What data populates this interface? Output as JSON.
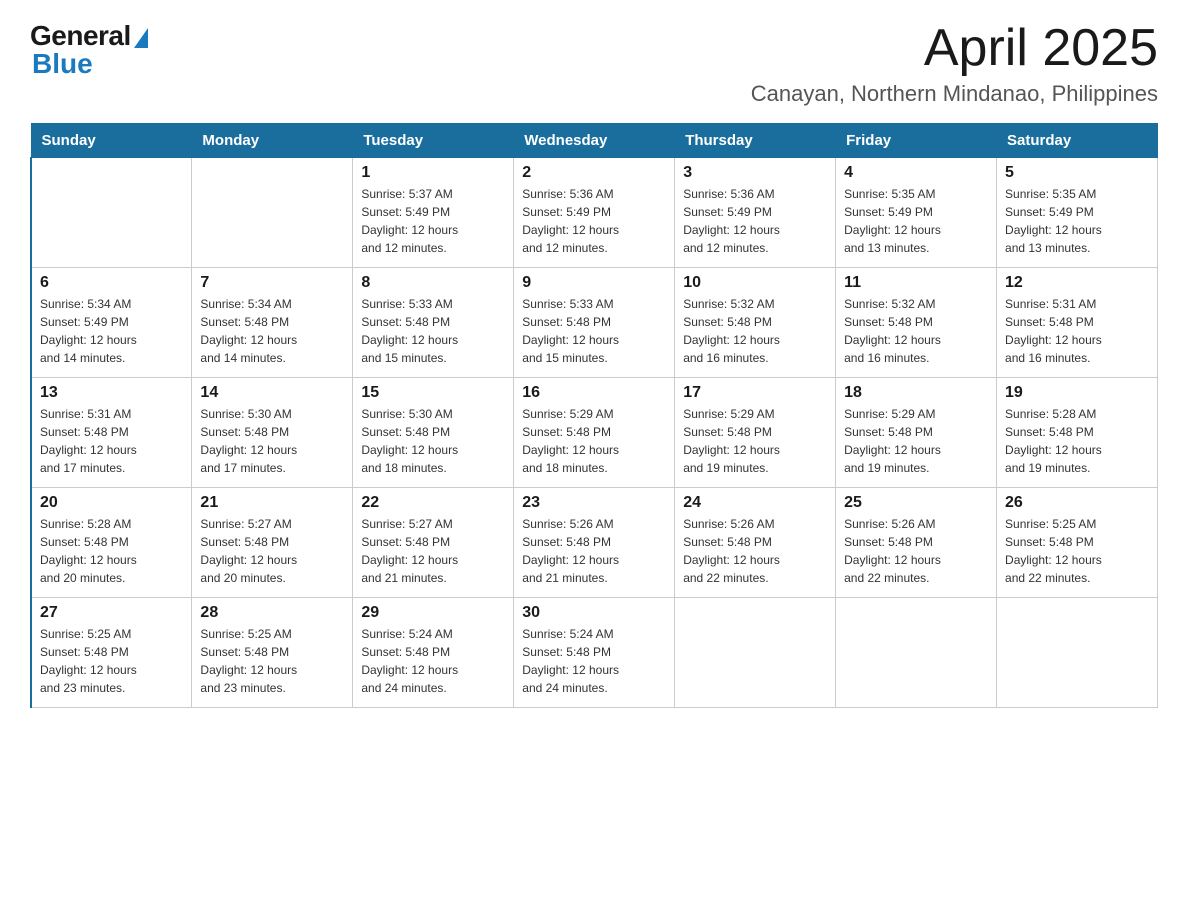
{
  "logo": {
    "general": "General",
    "blue": "Blue"
  },
  "title": "April 2025",
  "location": "Canayan, Northern Mindanao, Philippines",
  "days_of_week": [
    "Sunday",
    "Monday",
    "Tuesday",
    "Wednesday",
    "Thursday",
    "Friday",
    "Saturday"
  ],
  "weeks": [
    [
      {
        "day": "",
        "info": ""
      },
      {
        "day": "",
        "info": ""
      },
      {
        "day": "1",
        "info": "Sunrise: 5:37 AM\nSunset: 5:49 PM\nDaylight: 12 hours\nand 12 minutes."
      },
      {
        "day": "2",
        "info": "Sunrise: 5:36 AM\nSunset: 5:49 PM\nDaylight: 12 hours\nand 12 minutes."
      },
      {
        "day": "3",
        "info": "Sunrise: 5:36 AM\nSunset: 5:49 PM\nDaylight: 12 hours\nand 12 minutes."
      },
      {
        "day": "4",
        "info": "Sunrise: 5:35 AM\nSunset: 5:49 PM\nDaylight: 12 hours\nand 13 minutes."
      },
      {
        "day": "5",
        "info": "Sunrise: 5:35 AM\nSunset: 5:49 PM\nDaylight: 12 hours\nand 13 minutes."
      }
    ],
    [
      {
        "day": "6",
        "info": "Sunrise: 5:34 AM\nSunset: 5:49 PM\nDaylight: 12 hours\nand 14 minutes."
      },
      {
        "day": "7",
        "info": "Sunrise: 5:34 AM\nSunset: 5:48 PM\nDaylight: 12 hours\nand 14 minutes."
      },
      {
        "day": "8",
        "info": "Sunrise: 5:33 AM\nSunset: 5:48 PM\nDaylight: 12 hours\nand 15 minutes."
      },
      {
        "day": "9",
        "info": "Sunrise: 5:33 AM\nSunset: 5:48 PM\nDaylight: 12 hours\nand 15 minutes."
      },
      {
        "day": "10",
        "info": "Sunrise: 5:32 AM\nSunset: 5:48 PM\nDaylight: 12 hours\nand 16 minutes."
      },
      {
        "day": "11",
        "info": "Sunrise: 5:32 AM\nSunset: 5:48 PM\nDaylight: 12 hours\nand 16 minutes."
      },
      {
        "day": "12",
        "info": "Sunrise: 5:31 AM\nSunset: 5:48 PM\nDaylight: 12 hours\nand 16 minutes."
      }
    ],
    [
      {
        "day": "13",
        "info": "Sunrise: 5:31 AM\nSunset: 5:48 PM\nDaylight: 12 hours\nand 17 minutes."
      },
      {
        "day": "14",
        "info": "Sunrise: 5:30 AM\nSunset: 5:48 PM\nDaylight: 12 hours\nand 17 minutes."
      },
      {
        "day": "15",
        "info": "Sunrise: 5:30 AM\nSunset: 5:48 PM\nDaylight: 12 hours\nand 18 minutes."
      },
      {
        "day": "16",
        "info": "Sunrise: 5:29 AM\nSunset: 5:48 PM\nDaylight: 12 hours\nand 18 minutes."
      },
      {
        "day": "17",
        "info": "Sunrise: 5:29 AM\nSunset: 5:48 PM\nDaylight: 12 hours\nand 19 minutes."
      },
      {
        "day": "18",
        "info": "Sunrise: 5:29 AM\nSunset: 5:48 PM\nDaylight: 12 hours\nand 19 minutes."
      },
      {
        "day": "19",
        "info": "Sunrise: 5:28 AM\nSunset: 5:48 PM\nDaylight: 12 hours\nand 19 minutes."
      }
    ],
    [
      {
        "day": "20",
        "info": "Sunrise: 5:28 AM\nSunset: 5:48 PM\nDaylight: 12 hours\nand 20 minutes."
      },
      {
        "day": "21",
        "info": "Sunrise: 5:27 AM\nSunset: 5:48 PM\nDaylight: 12 hours\nand 20 minutes."
      },
      {
        "day": "22",
        "info": "Sunrise: 5:27 AM\nSunset: 5:48 PM\nDaylight: 12 hours\nand 21 minutes."
      },
      {
        "day": "23",
        "info": "Sunrise: 5:26 AM\nSunset: 5:48 PM\nDaylight: 12 hours\nand 21 minutes."
      },
      {
        "day": "24",
        "info": "Sunrise: 5:26 AM\nSunset: 5:48 PM\nDaylight: 12 hours\nand 22 minutes."
      },
      {
        "day": "25",
        "info": "Sunrise: 5:26 AM\nSunset: 5:48 PM\nDaylight: 12 hours\nand 22 minutes."
      },
      {
        "day": "26",
        "info": "Sunrise: 5:25 AM\nSunset: 5:48 PM\nDaylight: 12 hours\nand 22 minutes."
      }
    ],
    [
      {
        "day": "27",
        "info": "Sunrise: 5:25 AM\nSunset: 5:48 PM\nDaylight: 12 hours\nand 23 minutes."
      },
      {
        "day": "28",
        "info": "Sunrise: 5:25 AM\nSunset: 5:48 PM\nDaylight: 12 hours\nand 23 minutes."
      },
      {
        "day": "29",
        "info": "Sunrise: 5:24 AM\nSunset: 5:48 PM\nDaylight: 12 hours\nand 24 minutes."
      },
      {
        "day": "30",
        "info": "Sunrise: 5:24 AM\nSunset: 5:48 PM\nDaylight: 12 hours\nand 24 minutes."
      },
      {
        "day": "",
        "info": ""
      },
      {
        "day": "",
        "info": ""
      },
      {
        "day": "",
        "info": ""
      }
    ]
  ]
}
